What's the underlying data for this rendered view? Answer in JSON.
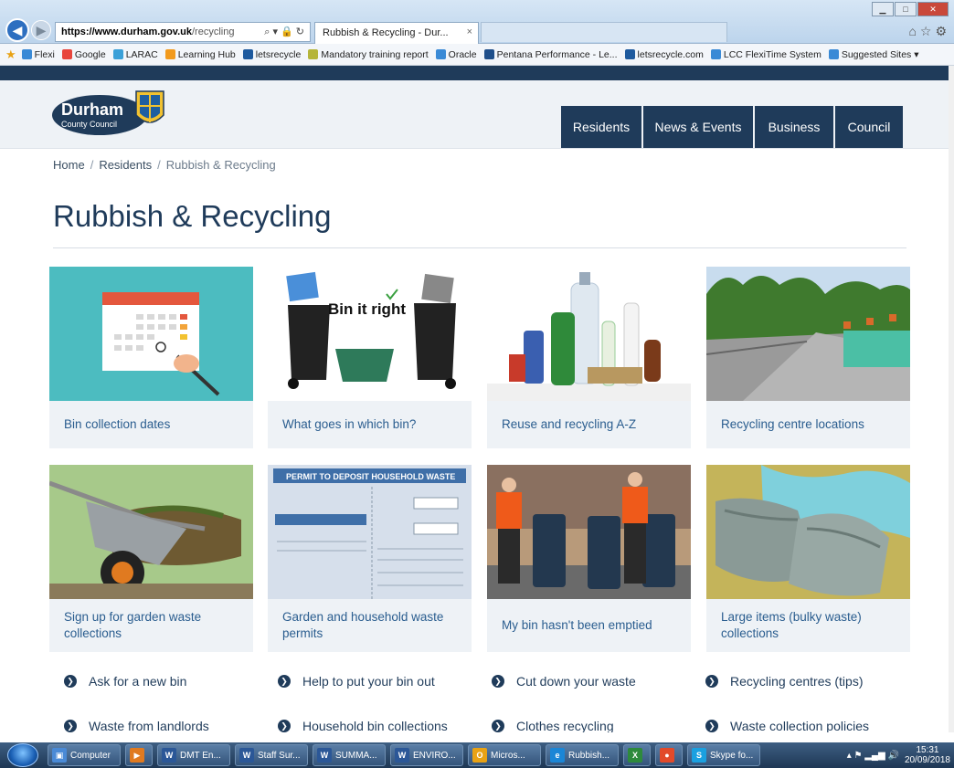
{
  "browser": {
    "url_host": "https://www.durham.gov.uk",
    "url_path": "/recycling",
    "tab_title": "Rubbish & Recycling - Dur...",
    "tab_close": "×"
  },
  "favorites": [
    {
      "label": "Flexi",
      "color": "#3a8ad6"
    },
    {
      "label": "Google",
      "color": "#e8453c"
    },
    {
      "label": "LARAC",
      "color": "#3aa0d8"
    },
    {
      "label": "Learning Hub",
      "color": "#f29a1d"
    },
    {
      "label": "letsrecycle",
      "color": "#1e5a9e"
    },
    {
      "label": "Mandatory training report",
      "color": "#b5b53a"
    },
    {
      "label": "Oracle",
      "color": "#3a8ad6"
    },
    {
      "label": "Pentana Performance - Le...",
      "color": "#1f4f8a"
    },
    {
      "label": "letsrecycle.com",
      "color": "#1e5a9e"
    },
    {
      "label": "LCC FlexiTime System",
      "color": "#3a8ad6"
    },
    {
      "label": "Suggested Sites ▾",
      "color": "#3a8ad6"
    }
  ],
  "logo": {
    "line1": "Durham",
    "line2": "County Council"
  },
  "nav": [
    {
      "label": "Residents",
      "width": 90
    },
    {
      "label": "News & Events",
      "width": 122
    },
    {
      "label": "Business",
      "width": 88
    },
    {
      "label": "Council",
      "width": 76
    }
  ],
  "breadcrumb": {
    "home": "Home",
    "sep": "/",
    "residents": "Residents",
    "current": "Rubbish & Recycling"
  },
  "page_title": "Rubbish & Recycling",
  "cards": [
    {
      "label": "Bin collection dates",
      "icon": "calendar-image"
    },
    {
      "label": "What goes in which bin?",
      "icon": "bins-image",
      "img_text": "Bin it right"
    },
    {
      "label": "Reuse and recycling A-Z",
      "icon": "bottles-image"
    },
    {
      "label": "Recycling centre locations",
      "icon": "recycling-centre-image"
    },
    {
      "label": "Sign up for garden waste collections",
      "icon": "wheelbarrow-image"
    },
    {
      "label": "Garden and household waste permits",
      "icon": "permit-image",
      "img_text": "PERMIT TO DEPOSIT HOUSEHOLD WASTE"
    },
    {
      "label": "My bin hasn't been emptied",
      "icon": "bin-workers-image"
    },
    {
      "label": "Large items (bulky waste) collections",
      "icon": "bulky-waste-image"
    }
  ],
  "links": [
    "Ask for a new bin",
    "Help to put your bin out",
    "Cut down your waste",
    "Recycling centres (tips)",
    "Waste from landlords",
    "Household bin collections",
    "Clothes recycling",
    "Waste collection policies"
  ],
  "taskbar": [
    {
      "label": "Computer",
      "color": "#4a8ad6",
      "glyph": "▣"
    },
    {
      "label": "",
      "color": "#e07a20",
      "glyph": "▶"
    },
    {
      "label": "DMT En...",
      "color": "#2b5797",
      "glyph": "W"
    },
    {
      "label": "Staff Sur...",
      "color": "#2b5797",
      "glyph": "W"
    },
    {
      "label": "SUMMA...",
      "color": "#2b5797",
      "glyph": "W"
    },
    {
      "label": "ENVIRO...",
      "color": "#2b5797",
      "glyph": "W"
    },
    {
      "label": "Micros...",
      "color": "#e8a215",
      "glyph": "O"
    },
    {
      "label": "Rubbish...",
      "color": "#1b86d6",
      "glyph": "e"
    },
    {
      "label": "",
      "color": "#2e8a3c",
      "glyph": "X"
    },
    {
      "label": "",
      "color": "#e24a2a",
      "glyph": "●"
    },
    {
      "label": "Skype fo...",
      "color": "#1aa0e0",
      "glyph": "S"
    }
  ],
  "clock": {
    "time": "15:31",
    "date": "20/09/2018"
  }
}
